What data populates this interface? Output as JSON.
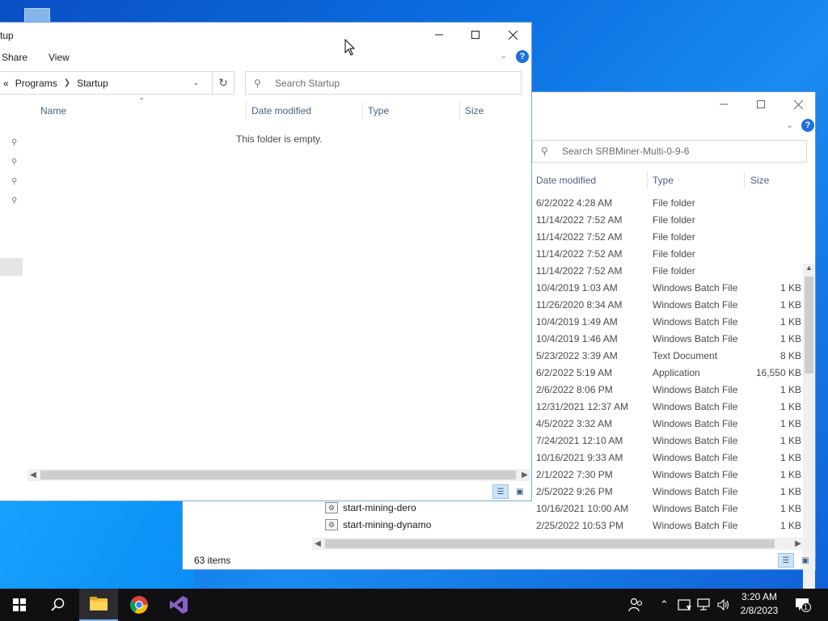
{
  "back_window": {
    "search_placeholder": "Search SRBMiner-Multi-0-9-6",
    "columns": {
      "date": "Date modified",
      "type": "Type",
      "size": "Size"
    },
    "rows": [
      {
        "date": "6/2/2022 4:28 AM",
        "type": "File folder",
        "size": ""
      },
      {
        "date": "11/14/2022 7:52 AM",
        "type": "File folder",
        "size": ""
      },
      {
        "date": "11/14/2022 7:52 AM",
        "type": "File folder",
        "size": ""
      },
      {
        "date": "11/14/2022 7:52 AM",
        "type": "File folder",
        "size": ""
      },
      {
        "date": "11/14/2022 7:52 AM",
        "type": "File folder",
        "size": ""
      },
      {
        "date": "10/4/2019 1:03 AM",
        "type": "Windows Batch File",
        "size": "1 KB"
      },
      {
        "date": "11/26/2020 8:34 AM",
        "type": "Windows Batch File",
        "size": "1 KB"
      },
      {
        "date": "10/4/2019 1:49 AM",
        "type": "Windows Batch File",
        "size": "1 KB"
      },
      {
        "date": "10/4/2019 1:46 AM",
        "type": "Windows Batch File",
        "size": "1 KB"
      },
      {
        "date": "5/23/2022 3:39 AM",
        "type": "Text Document",
        "size": "8 KB"
      },
      {
        "date": "6/2/2022 5:19 AM",
        "type": "Application",
        "size": "16,550 KB"
      },
      {
        "date": "2/6/2022 8:06 PM",
        "type": "Windows Batch File",
        "size": "1 KB"
      },
      {
        "date": "12/31/2021 12:37 AM",
        "type": "Windows Batch File",
        "size": "1 KB"
      },
      {
        "date": "4/5/2022 3:32 AM",
        "type": "Windows Batch File",
        "size": "1 KB"
      },
      {
        "date": "7/24/2021 12:10 AM",
        "type": "Windows Batch File",
        "size": "1 KB"
      },
      {
        "date": "10/16/2021 9:33 AM",
        "type": "Windows Batch File",
        "size": "1 KB"
      },
      {
        "date": "2/1/2022 7:30 PM",
        "type": "Windows Batch File",
        "size": "1 KB"
      },
      {
        "date": "2/5/2022 9:26 PM",
        "type": "Windows Batch File",
        "size": "1 KB"
      },
      {
        "date": "10/16/2021 10:00 AM",
        "type": "Windows Batch File",
        "size": "1 KB"
      },
      {
        "date": "2/25/2022 10:53 PM",
        "type": "Windows Batch File",
        "size": "1 KB"
      }
    ],
    "visible_names": [
      "start-mining-dero",
      "start-mining-dynamo"
    ],
    "status": "63 items"
  },
  "front_window": {
    "title": "tup",
    "ribbon": {
      "share": "Share",
      "view": "View"
    },
    "breadcrumb": {
      "overflow": "«",
      "programs": "Programs",
      "startup": "Startup"
    },
    "search_placeholder": "Search Startup",
    "columns": {
      "name": "Name",
      "date": "Date modified",
      "type": "Type",
      "size": "Size"
    },
    "empty_text": "This folder is empty."
  },
  "taskbar": {
    "icons": [
      "windows-start-icon",
      "search-icon",
      "file-explorer-icon",
      "chrome-icon",
      "visual-studio-icon"
    ],
    "clock": {
      "time": "3:20 AM",
      "date": "2/8/2023"
    },
    "notification_count": "1"
  },
  "colors": {
    "accent": "#0078d7",
    "help": "#1e6fd9",
    "taskbar": "#101013"
  }
}
